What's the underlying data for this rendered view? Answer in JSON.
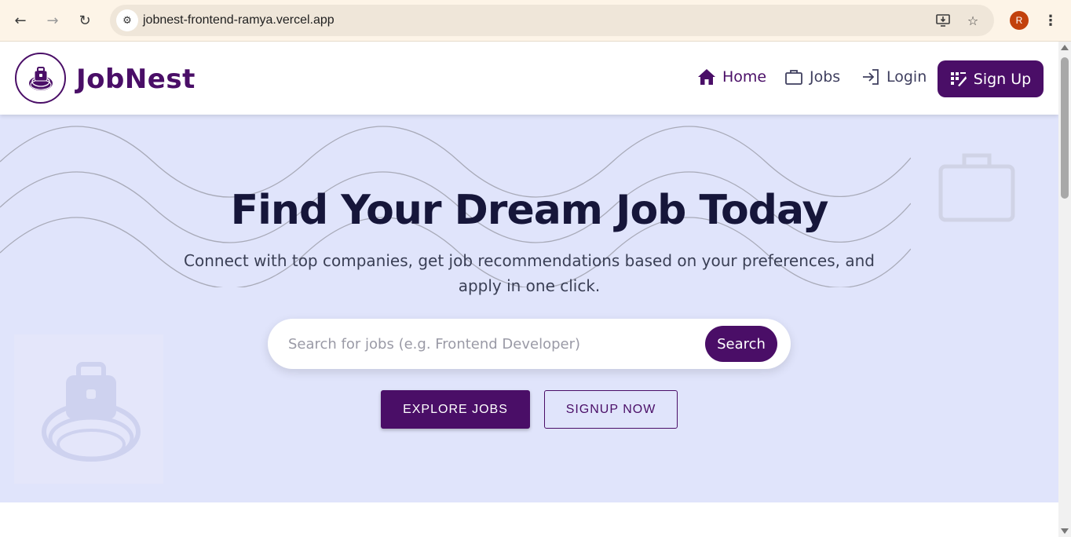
{
  "browser": {
    "url": "jobnest-frontend-ramya.vercel.app",
    "profile_initial": "R",
    "icons": [
      "back-arrow-icon",
      "forward-arrow-icon",
      "reload-icon",
      "site-settings-icon",
      "install-app-icon",
      "bookmark-star-icon",
      "more-menu-icon"
    ]
  },
  "header": {
    "brand": "JobNest",
    "nav": {
      "home": "Home",
      "jobs": "Jobs",
      "login": "Login",
      "signup": "Sign Up"
    }
  },
  "hero": {
    "title": "Find Your Dream Job Today",
    "subtitle": "Connect with top companies, get job recommendations based on your preferences, and apply in one click.",
    "search": {
      "placeholder": "Search for jobs (e.g. Frontend Developer)",
      "button": "Search"
    },
    "explore_button": "EXPLORE JOBS",
    "signup_button": "SIGNUP NOW"
  },
  "colors": {
    "brand": "#4a0e67",
    "hero_bg": "#e0e4fb",
    "chrome_bg": "#fdf4e7"
  }
}
